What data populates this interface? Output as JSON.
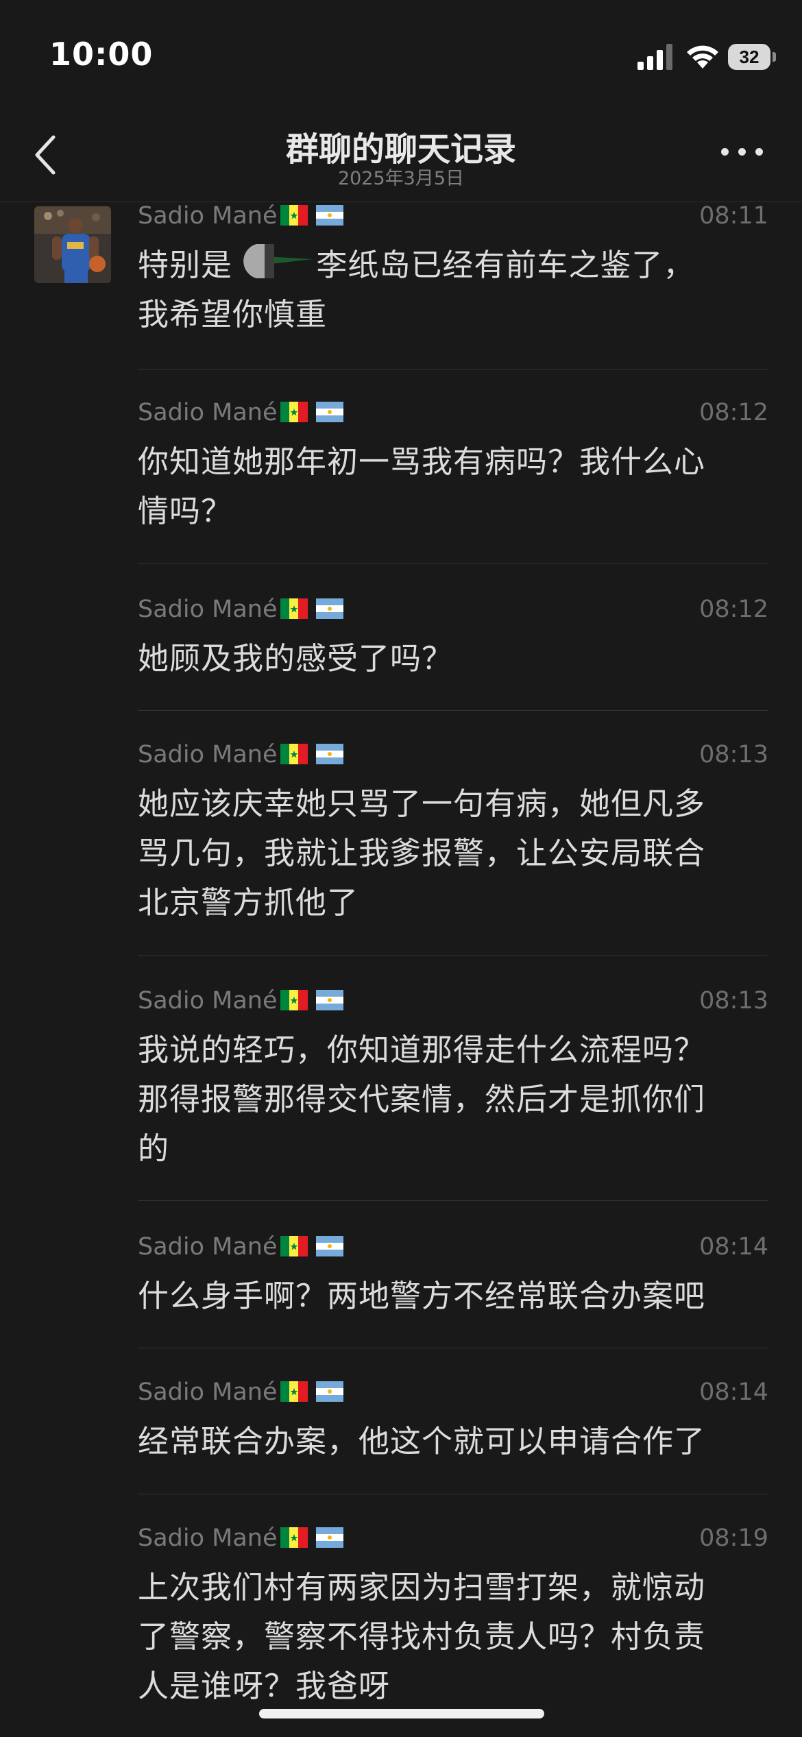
{
  "status_bar": {
    "time": "10:00",
    "battery": "32",
    "icons": [
      "signal-icon",
      "wifi-icon",
      "battery-icon"
    ]
  },
  "nav": {
    "title": "群聊的聊天记录",
    "subtitle": "2025年3月5日",
    "back_icon": "chevron-left-icon",
    "more_icon": "more-dots-icon"
  },
  "messages": [
    {
      "sender": "Sadio Mané",
      "time": "08:11",
      "text": "特别是        李纸岛已经有前车之鉴了，\n我希望你慎重"
    },
    {
      "sender": "Sadio Mané",
      "time": "08:12",
      "text": "你知道她那年初一骂我有病吗？我什么心\n情吗？"
    },
    {
      "sender": "Sadio Mané",
      "time": "08:12",
      "text": "她顾及我的感受了吗？"
    },
    {
      "sender": "Sadio Mané",
      "time": "08:13",
      "text": "她应该庆幸她只骂了一句有病，她但凡多\n骂几句，我就让我爹报警，让公安局联合\n北京警方抓他了"
    },
    {
      "sender": "Sadio Mané",
      "time": "08:13",
      "text": "我说的轻巧，你知道那得走什么流程吗？\n那得报警那得交代案情，然后才是抓你们\n的"
    },
    {
      "sender": "Sadio Mané",
      "time": "08:14",
      "text": "什么身手啊？两地警方不经常联合办案吧"
    },
    {
      "sender": "Sadio Mané",
      "time": "08:14",
      "text": "经常联合办案，他这个就可以申请合作了"
    },
    {
      "sender": "Sadio Mané",
      "time": "08:19",
      "text": "上次我们村有两家因为扫雪打架，就惊动\n了警察，警察不得找村负责人吗？村负责\n人是谁呀？我爸呀"
    }
  ],
  "flag_icons": [
    "senegal-flag-icon",
    "argentina-flag-icon"
  ],
  "colors": {
    "background": "#191919",
    "text": "#dcdcdc",
    "meta": "#7a7a7a"
  }
}
